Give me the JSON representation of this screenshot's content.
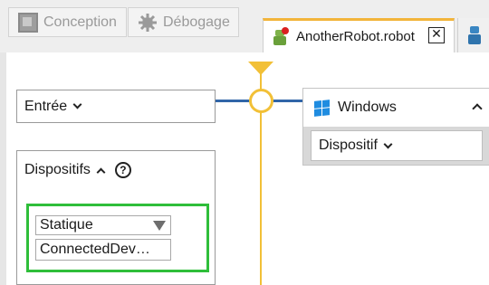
{
  "toolbar": {
    "conception_label": "Conception",
    "debug_label": "Débogage"
  },
  "tabs": {
    "active_tab_label": "AnotherRobot.robot",
    "close_glyph": "✕",
    "active_tab_accent": "#f2b43a"
  },
  "canvas": {
    "entree_label": "Entrée",
    "dispositifs_label": "Dispositifs",
    "help_glyph": "?",
    "select_value": "Statique",
    "device_field_value": "ConnectedDev…",
    "highlight_color": "#2fbe3a",
    "flow_line_color": "#f2c037",
    "connector_color": "#3166a8"
  },
  "windows_panel": {
    "title": "Windows",
    "dispositif_label": "Dispositif",
    "logo_color": "#1f8ce0"
  },
  "icons": [
    "conception-icon",
    "debug-gear-icon",
    "robot-icon",
    "close-icon",
    "robot-blue-icon",
    "chevron-down-icon",
    "chevron-up-icon",
    "help-icon",
    "dropdown-triangle-icon",
    "windows-logo-icon"
  ]
}
